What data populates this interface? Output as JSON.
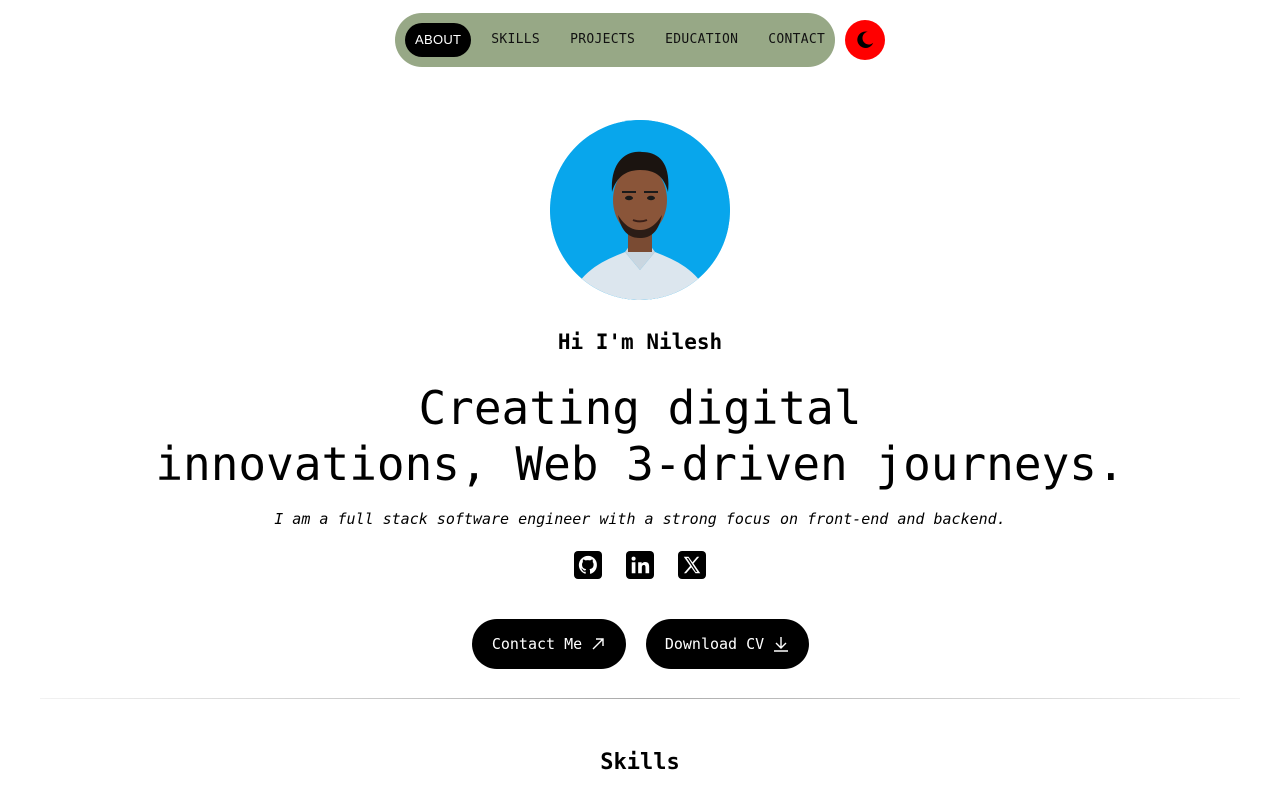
{
  "nav": {
    "items": [
      {
        "label": "ABOUT",
        "active": true
      },
      {
        "label": "SKILLS",
        "active": false
      },
      {
        "label": "PROJECTS",
        "active": false
      },
      {
        "label": "EDUCATION",
        "active": false
      },
      {
        "label": "CONTACT",
        "active": false
      }
    ],
    "theme_toggle_icon": "moon-icon"
  },
  "hero": {
    "avatar_icon": "profile-photo",
    "greeting": "Hi I'm Nilesh",
    "headline_line1": "Creating digital",
    "headline_line2": "innovations, Web 3-driven journeys.",
    "tagline": "I am a full stack software engineer with a strong focus on front-end and backend.",
    "socials": [
      {
        "icon": "github-icon"
      },
      {
        "icon": "linkedin-icon"
      },
      {
        "icon": "x-twitter-icon"
      }
    ],
    "contact_button": "Contact Me",
    "cv_button": "Download CV"
  },
  "skills": {
    "title": "Skills"
  },
  "colors": {
    "nav_bg": "#97a886",
    "toggle_bg": "#ff0000",
    "avatar_bg": "#08a6ec",
    "button_bg": "#000000"
  }
}
